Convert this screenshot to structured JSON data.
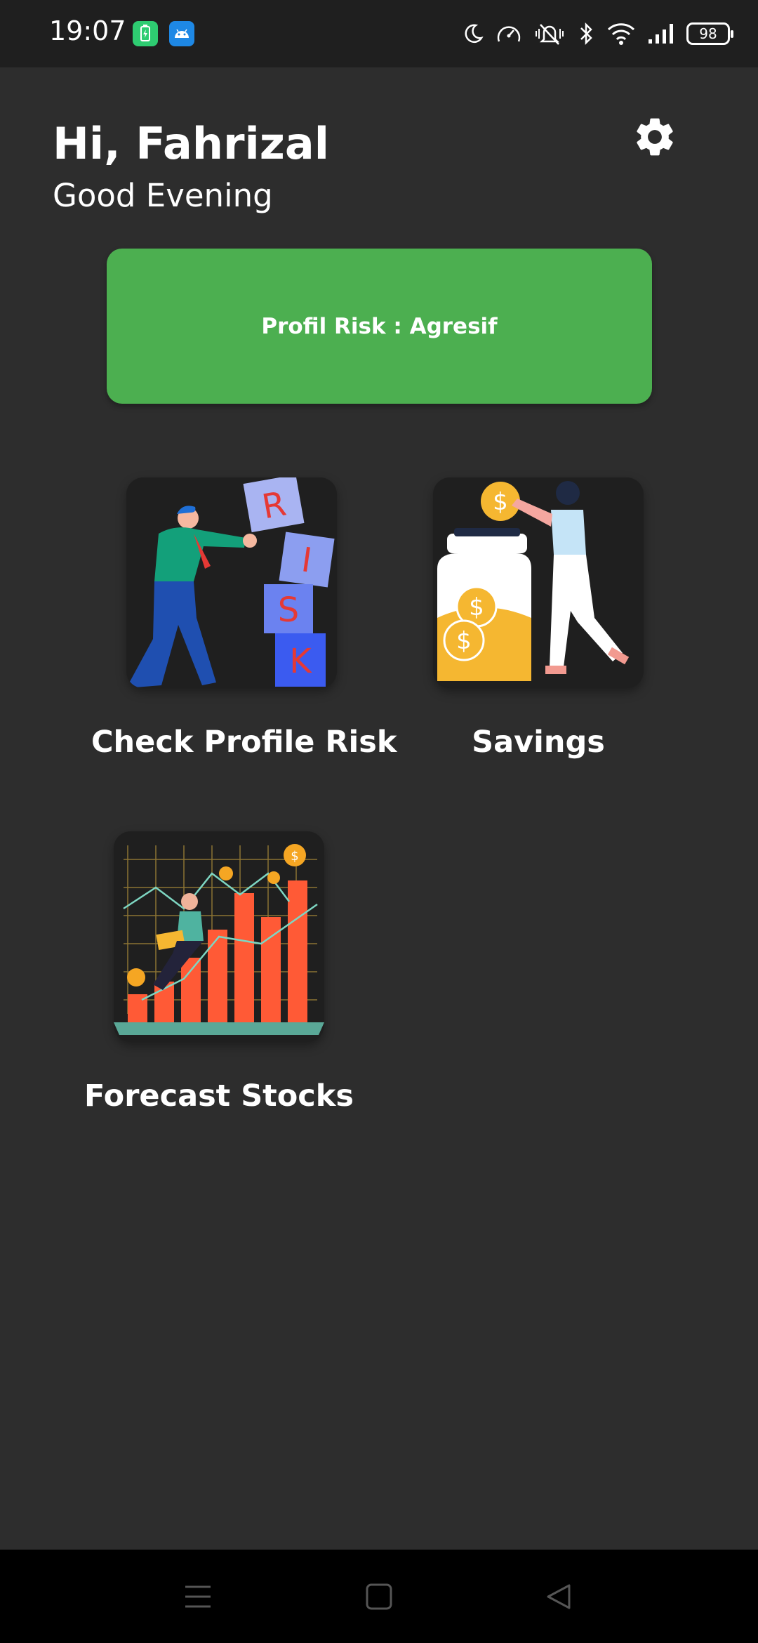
{
  "status_bar": {
    "time": "19:07",
    "battery": "98",
    "icons": [
      "battery-saver-app-icon",
      "android-app-icon",
      "moon-icon",
      "speedometer-icon",
      "mute-icon",
      "bluetooth-icon",
      "wifi-icon",
      "signal-icon",
      "battery-icon"
    ]
  },
  "header": {
    "greeting": "Hi, Fahrizal",
    "subgreeting": "Good Evening",
    "settings_icon": "gear-icon"
  },
  "risk_banner": {
    "label": "Profil Risk : Agresif",
    "color": "#4caf50"
  },
  "menu": {
    "items": [
      {
        "label": "Check Profile Risk",
        "icon": "risk-blocks-illustration"
      },
      {
        "label": "Savings",
        "icon": "savings-jar-illustration"
      },
      {
        "label": "Forecast Stocks",
        "icon": "stock-chart-illustration"
      }
    ]
  },
  "nav_bar": {
    "icons": [
      "menu-icon",
      "home-icon",
      "back-icon"
    ]
  },
  "colors": {
    "background": "#2d2d2d",
    "accent": "#4caf50"
  }
}
